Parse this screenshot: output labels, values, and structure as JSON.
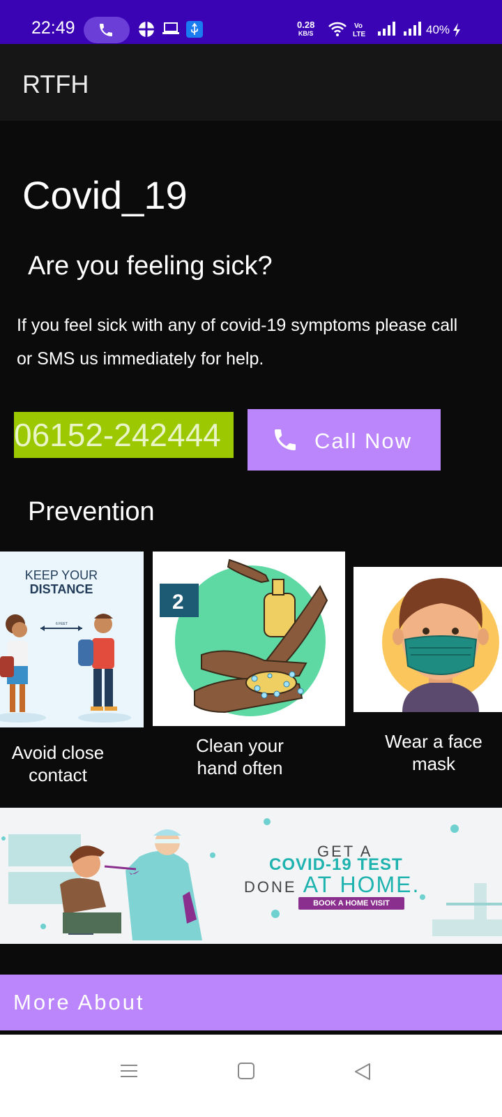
{
  "status_bar": {
    "time": "22:49",
    "net_speed_value": "0.28",
    "net_speed_unit": "KB/S",
    "battery": "40%",
    "icons": [
      "phone-call-pill",
      "grid-icon",
      "laptop-icon",
      "usb-icon",
      "wifi-icon",
      "volte-icon",
      "signal-icon",
      "signal-icon",
      "charging-icon"
    ]
  },
  "app_bar": {
    "title": "RTFH"
  },
  "main": {
    "heading": "Covid_19",
    "subheading": "Are you feeling sick?",
    "body": "If you feel sick with any of covid-19 symptoms please call or SMS us immediately for help.",
    "phone_number": "06152-242444",
    "call_button_label": "Call Now",
    "prevention_heading": "Prevention"
  },
  "prevention_cards": [
    {
      "caption": "Avoid close contact",
      "image_text_1": "KEEP YOUR",
      "image_text_2": "DISTANCE",
      "image_text_3": "6 FEET"
    },
    {
      "caption": "Clean your hand often",
      "image_text_1": "2"
    },
    {
      "caption": "Wear a face mask"
    }
  ],
  "banner": {
    "line1": "GET A",
    "line2": "COVID-19 TEST",
    "line3a": "DONE",
    "line3b": "AT HOME.",
    "button": "BOOK A HOME VISIT"
  },
  "more_about_label": "More About",
  "colors": {
    "status_bar": "#3a04b5",
    "accent": "#bb86fc",
    "phone_bg": "#9bc800",
    "background": "#0b0b0b"
  }
}
